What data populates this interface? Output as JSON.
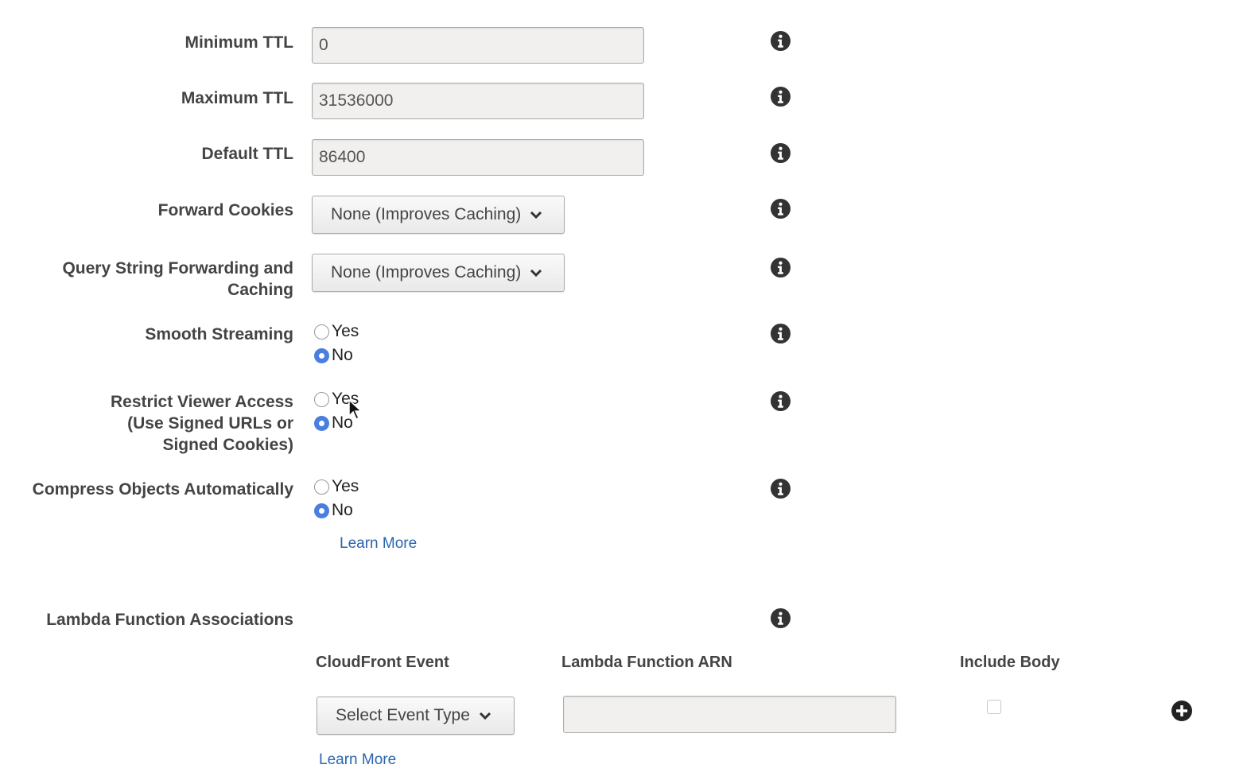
{
  "fields": {
    "min_ttl": {
      "label": "Minimum TTL",
      "value": "0"
    },
    "max_ttl": {
      "label": "Maximum TTL",
      "value": "31536000"
    },
    "default_ttl": {
      "label": "Default TTL",
      "value": "86400"
    },
    "forward_cookies": {
      "label": "Forward Cookies",
      "selected": "None (Improves Caching)"
    },
    "query_string": {
      "label_line1": "Query String Forwarding and",
      "label_line2": "Caching",
      "selected": "None (Improves Caching)"
    },
    "smooth_streaming": {
      "label": "Smooth Streaming",
      "yes": "Yes",
      "no": "No",
      "value": "No"
    },
    "restrict_viewer": {
      "label_line1": "Restrict Viewer Access",
      "label_line2": "(Use Signed URLs or",
      "label_line3": "Signed Cookies)",
      "yes": "Yes",
      "no": "No",
      "value": "No"
    },
    "compress": {
      "label": "Compress Objects Automatically",
      "yes": "Yes",
      "no": "No",
      "value": "No",
      "learn_more": "Learn More"
    }
  },
  "lambda": {
    "label": "Lambda Function Associations",
    "col_event": "CloudFront Event",
    "col_arn": "Lambda Function ARN",
    "col_body": "Include Body",
    "event_select": "Select Event Type",
    "arn_value": "",
    "include_body": false,
    "learn_more": "Learn More"
  },
  "icons": {
    "info": "info-circle-icon",
    "chevron": "chevron-down-icon",
    "add": "plus-circle-icon"
  },
  "colors": {
    "link": "#2a65b0",
    "radio_checked": "#4a7fe0",
    "label_text": "#444444",
    "input_bg": "#f1f0ee"
  }
}
